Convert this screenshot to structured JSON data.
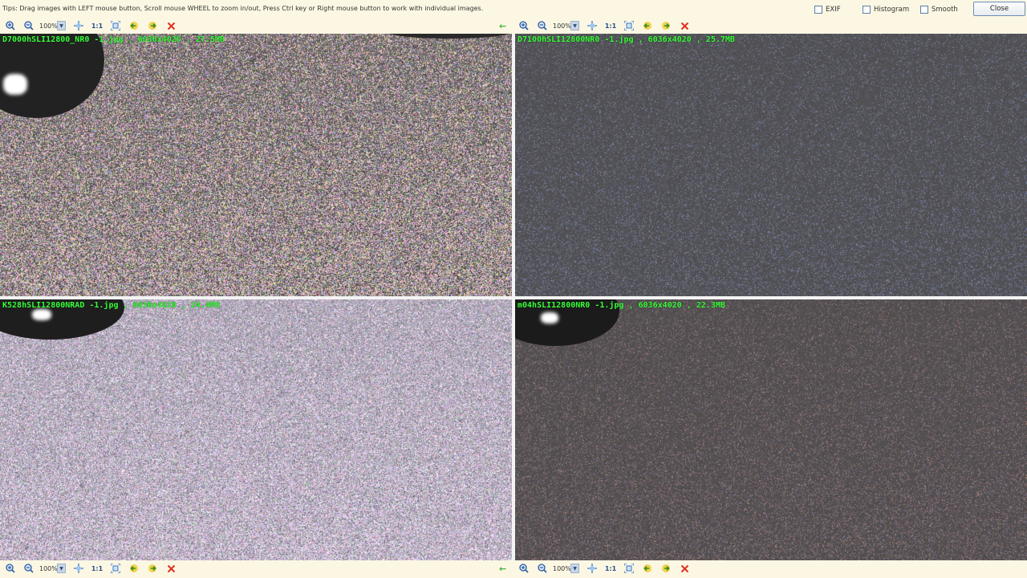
{
  "tips": "Tips: Drag images with LEFT mouse button, Scroll mouse WHEEL to zoom in/out, Press Ctrl key or Right mouse button to work with individual images.",
  "options": {
    "exif_label": "EXIF",
    "histogram_label": "Histogram",
    "smooth_label": "Smooth",
    "close_label": "Close"
  },
  "toolbar": {
    "zoom_value": "100%",
    "one_to_one_label": "1:1"
  },
  "panels": [
    {
      "label": "D7000hSLI12800_NR0 -1.jpg , 6036x4020 , 27.5MB",
      "style": "high-noise-pink"
    },
    {
      "label": "D7100hSLI12800NR0 -1.jpg , 6036x4020 , 25.7MB",
      "style": "low-noise-gray"
    },
    {
      "label": "K528hSLI12800NRAD -1.jpg , 6036x4020 , 24.4MB",
      "style": "high-noise-lavender"
    },
    {
      "label": "m04hSLI12800NR0 -1.jpg , 6036x4020 , 22.3MB",
      "style": "low-noise-gray-warm"
    }
  ],
  "icons": {
    "zoom_in": "zoom-in-icon",
    "zoom_out": "zoom-out-icon",
    "fit": "fit-window-icon",
    "fullscreen": "fullscreen-icon",
    "prev": "previous-image-icon",
    "next": "next-image-icon",
    "close": "close-x-icon"
  },
  "colors": {
    "label_text": "#3bff3b",
    "background": "#fbf7e3",
    "close_x": "#e03020"
  }
}
